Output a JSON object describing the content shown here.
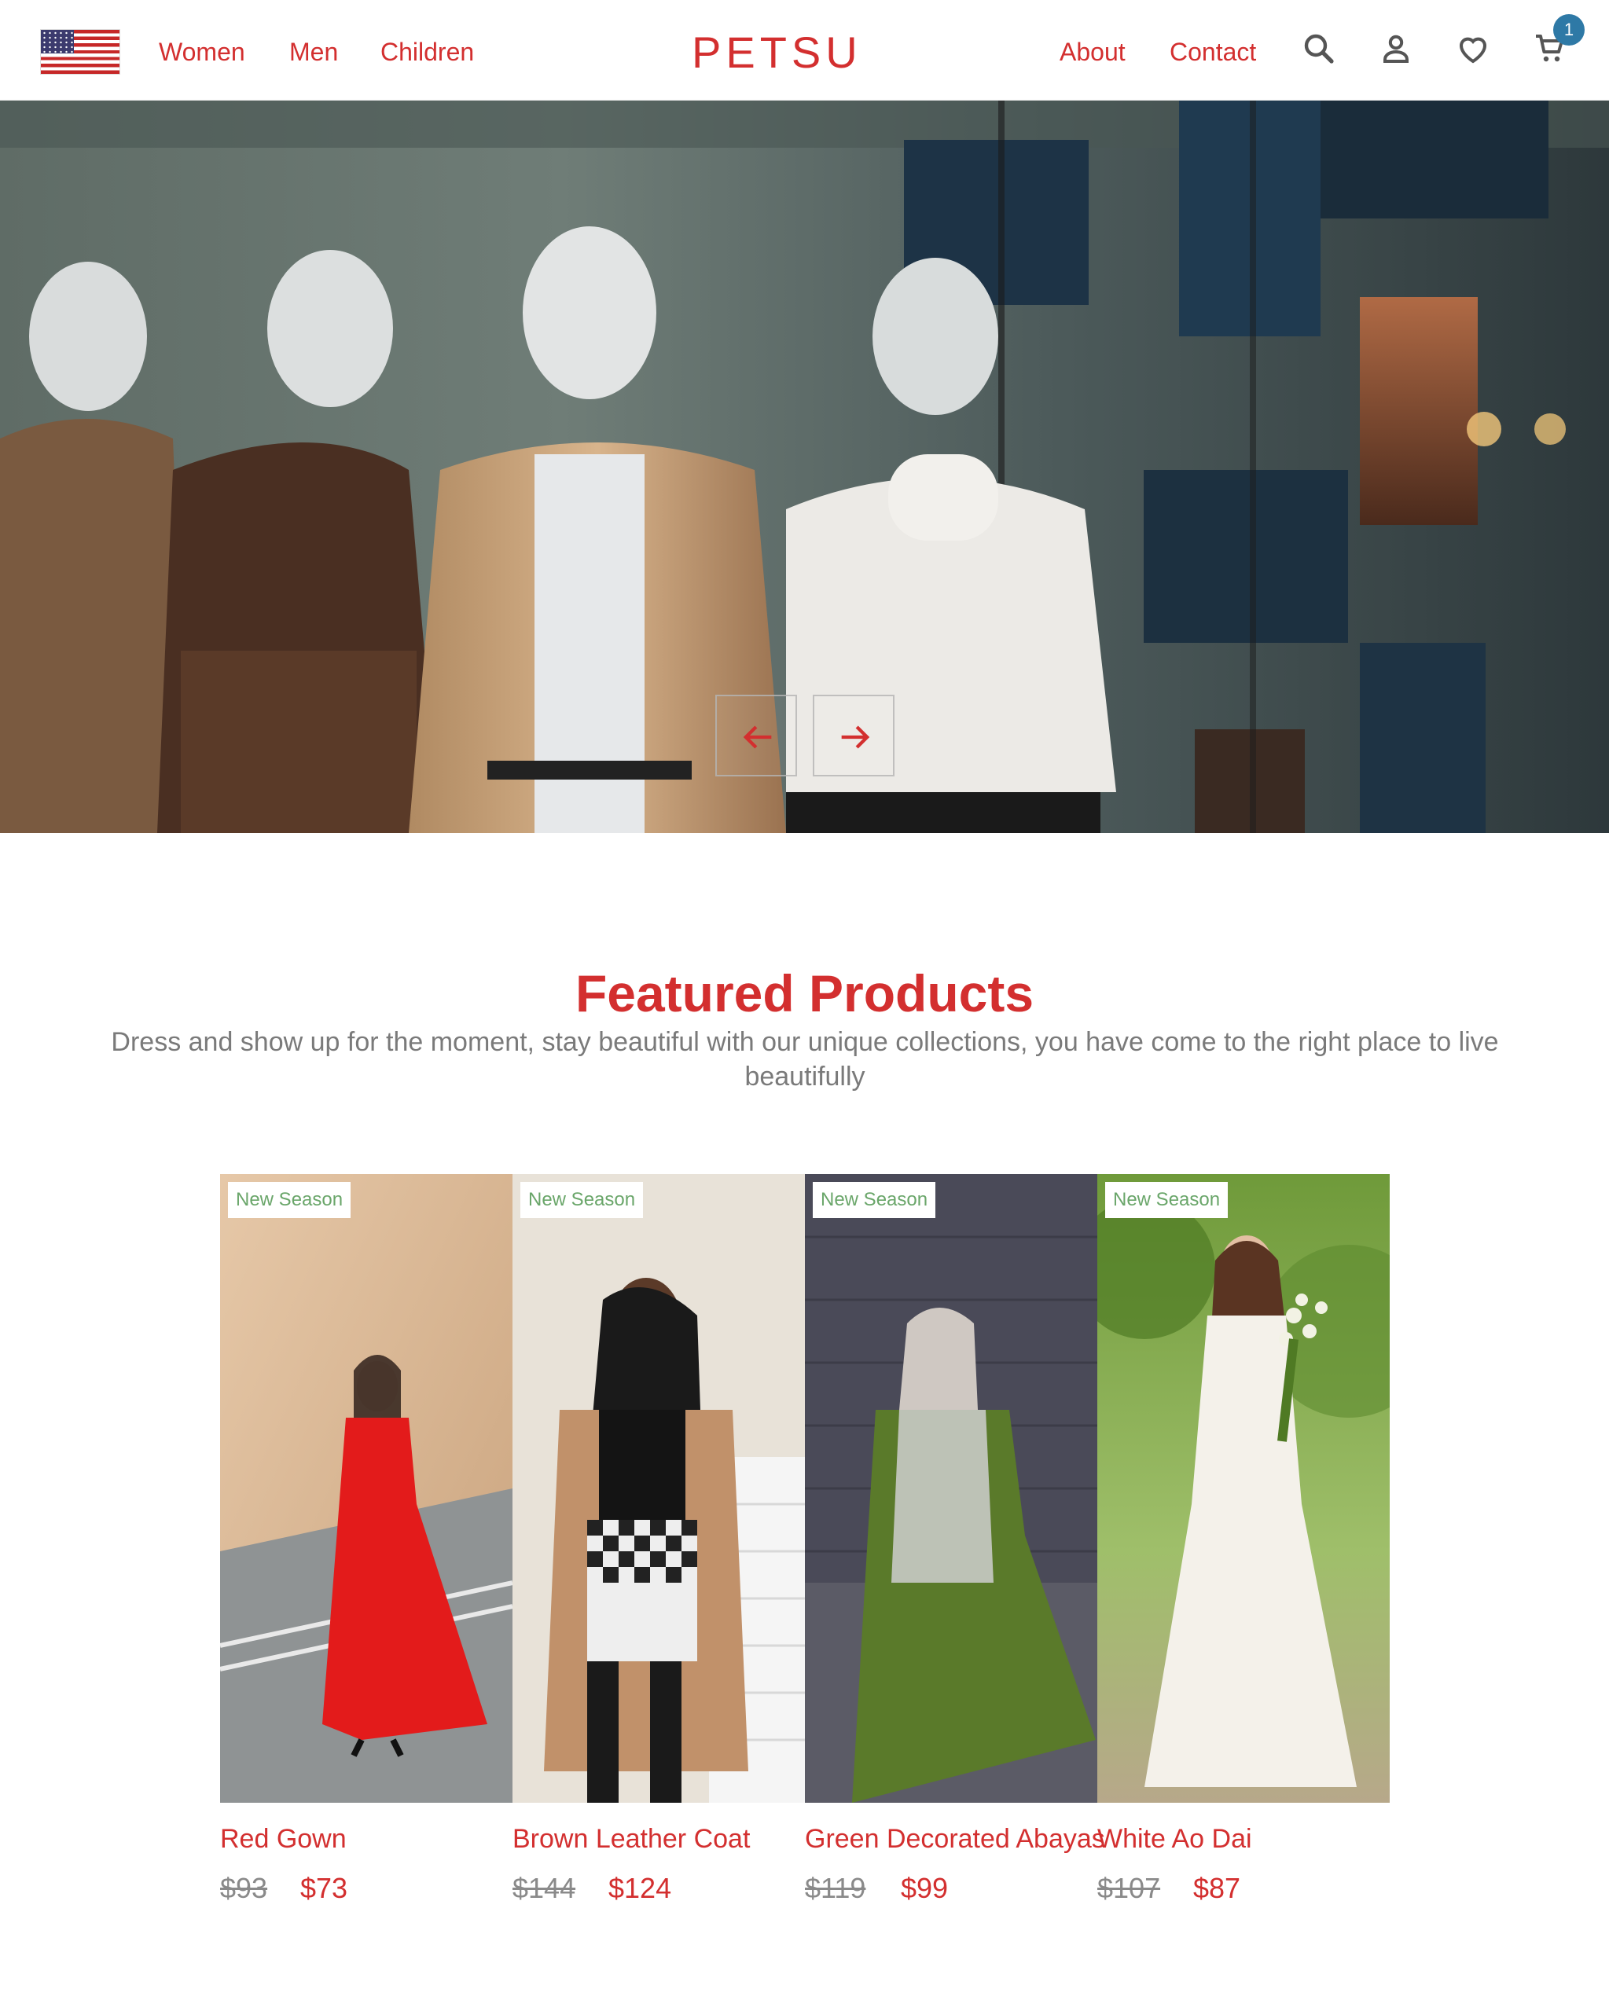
{
  "colors": {
    "accent": "#d32f2f",
    "badge_bg": "#2e79a6",
    "new_season_text": "#6aa66a",
    "muted_text": "#7a7a7a"
  },
  "nav": {
    "flag_icon": "us-flag-icon",
    "left_links": [
      "Women",
      "Men",
      "Children"
    ],
    "logo": "PETSU",
    "right_links": [
      "About",
      "Contact"
    ],
    "icons": [
      "search-icon",
      "user-icon",
      "heart-icon",
      "cart-icon"
    ],
    "cart_count": "1"
  },
  "hero": {
    "prev_icon": "arrow-left-icon",
    "next_icon": "arrow-right-icon"
  },
  "featured": {
    "title": "Featured Products",
    "description": "Dress and show up for the moment, stay beautiful with our unique collections, you have come to the right place to live beautifully",
    "products": [
      {
        "badge": "New Season",
        "name": "Red Gown",
        "old_price": "$93",
        "price": "$73"
      },
      {
        "badge": "New Season",
        "name": "Brown Leather Coat",
        "old_price": "$144",
        "price": "$124"
      },
      {
        "badge": "New Season",
        "name": "Green Decorated Abayas",
        "old_price": "$119",
        "price": "$99"
      },
      {
        "badge": "New Season",
        "name": "White Ao Dai",
        "old_price": "$107",
        "price": "$87"
      }
    ]
  }
}
